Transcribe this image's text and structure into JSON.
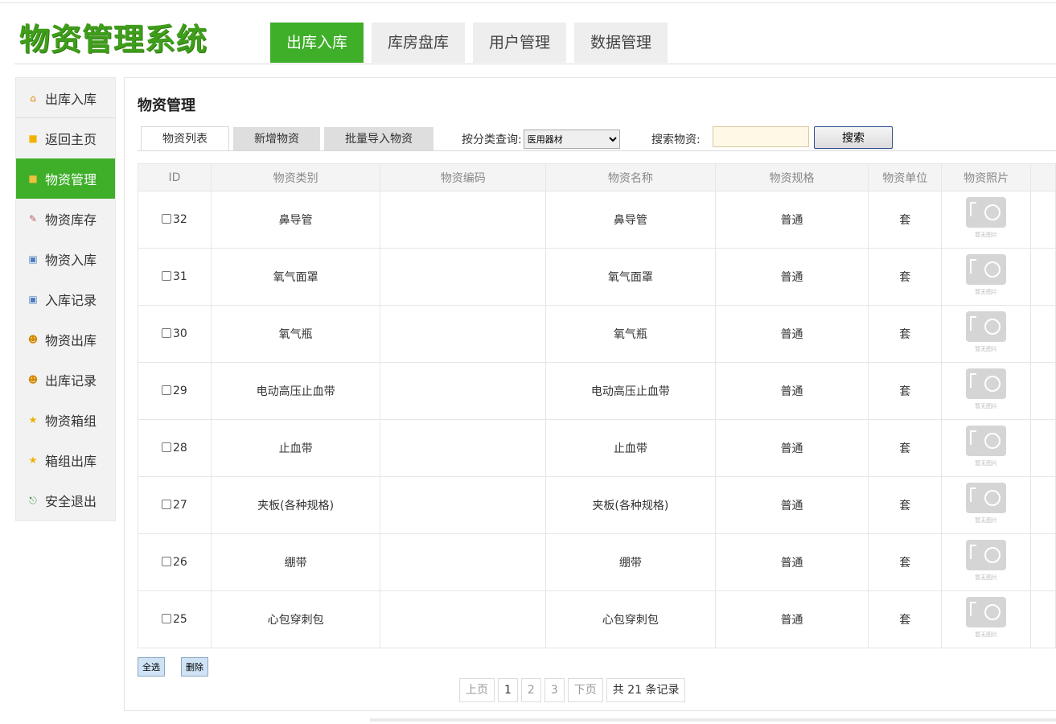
{
  "app": {
    "logo": "物资管理系统"
  },
  "topnav": [
    {
      "label": "出库入库",
      "active": true
    },
    {
      "label": "库房盘库",
      "active": false
    },
    {
      "label": "用户管理",
      "active": false
    },
    {
      "label": "数据管理",
      "active": false
    }
  ],
  "sidebar": [
    {
      "label": "出库入库",
      "icon": "home-icon",
      "glyph": "⌂",
      "color": "#e08a00"
    },
    {
      "label": "返回主页",
      "icon": "folder-icon",
      "glyph": "■",
      "color": "#f0b400"
    },
    {
      "label": "物资管理",
      "icon": "folder-icon",
      "glyph": "■",
      "color": "#f0c040"
    },
    {
      "label": "物资库存",
      "icon": "edit-icon",
      "glyph": "✎",
      "color": "#c06060"
    },
    {
      "label": "物资入库",
      "icon": "computer-icon",
      "glyph": "▣",
      "color": "#4d7fc0"
    },
    {
      "label": "入库记录",
      "icon": "computer-icon",
      "glyph": "▣",
      "color": "#4d7fc0"
    },
    {
      "label": "物资出库",
      "icon": "user-icon",
      "glyph": "☻",
      "color": "#d48a00"
    },
    {
      "label": "出库记录",
      "icon": "user-icon",
      "glyph": "☻",
      "color": "#d48a00"
    },
    {
      "label": "物资箱组",
      "icon": "star-icon",
      "glyph": "★",
      "color": "#f0b000"
    },
    {
      "label": "箱组出库",
      "icon": "star-icon",
      "glyph": "★",
      "color": "#f0b000"
    },
    {
      "label": "安全退出",
      "icon": "exit-icon",
      "glyph": "⎋",
      "color": "#3a8f3a"
    }
  ],
  "main": {
    "title": "物资管理",
    "subtabs": [
      {
        "label": "物资列表",
        "active": true
      },
      {
        "label": "新增物资",
        "active": false
      },
      {
        "label": "批量导入物资",
        "active": false
      }
    ],
    "filter_label": "按分类查询:",
    "filter_selected": "医用器材",
    "search_label": "搜索物资:",
    "search_value": "",
    "search_button": "搜索"
  },
  "table": {
    "headers": [
      "ID",
      "物资类别",
      "物资编码",
      "物资名称",
      "物资规格",
      "物资单位",
      "物资照片",
      ""
    ],
    "photo_caption": "暂无图片",
    "rows": [
      {
        "id": "32",
        "category": "鼻导管",
        "code": "",
        "name": "鼻导管",
        "spec": "普通",
        "unit": "套"
      },
      {
        "id": "31",
        "category": "氧气面罩",
        "code": "",
        "name": "氧气面罩",
        "spec": "普通",
        "unit": "套"
      },
      {
        "id": "30",
        "category": "氧气瓶",
        "code": "",
        "name": "氧气瓶",
        "spec": "普通",
        "unit": "套"
      },
      {
        "id": "29",
        "category": "电动高压止血带",
        "code": "",
        "name": "电动高压止血带",
        "spec": "普通",
        "unit": "套"
      },
      {
        "id": "28",
        "category": "止血带",
        "code": "",
        "name": "止血带",
        "spec": "普通",
        "unit": "套"
      },
      {
        "id": "27",
        "category": "夹板(各种规格)",
        "code": "",
        "name": "夹板(各种规格)",
        "spec": "普通",
        "unit": "套"
      },
      {
        "id": "26",
        "category": "绷带",
        "code": "",
        "name": "绷带",
        "spec": "普通",
        "unit": "套"
      },
      {
        "id": "25",
        "category": "心包穿刺包",
        "code": "",
        "name": "心包穿刺包",
        "spec": "普通",
        "unit": "套"
      }
    ]
  },
  "actions": {
    "select_all": "全选",
    "delete": "删除"
  },
  "pager": {
    "prev": "上页",
    "pages": [
      "1",
      "2",
      "3"
    ],
    "current": "1",
    "next": "下页",
    "total": "共 21 条记录"
  }
}
